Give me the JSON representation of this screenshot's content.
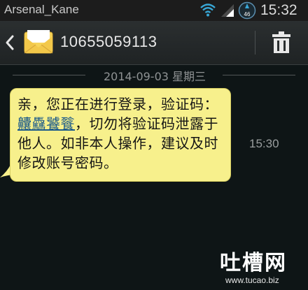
{
  "status_bar": {
    "carrier": "Arsenal_Kane",
    "network_badge": "46",
    "time": "15:32",
    "icons": [
      "wifi-icon",
      "signal-icon",
      "network-activity-icon"
    ]
  },
  "header": {
    "contact": "10655059113",
    "icons": [
      "back-icon",
      "envelope-icon",
      "trash-icon"
    ]
  },
  "conversation": {
    "date_separator": "2014-09-03 星期三",
    "messages": [
      {
        "text_before": "亲，您正在进行登录，验证码：",
        "code": "齉驫饕餮",
        "text_after": "，切勿将验证码泄露于他人。如非本人操作，建议及时修改账号密码。",
        "time": "15:30"
      }
    ]
  },
  "watermark": {
    "text": "吐槽网",
    "url": "www.tucao.biz"
  },
  "colors": {
    "background": "#0e1516",
    "bubble": "#f7f08c",
    "header": "#2b2f30",
    "link": "#1d5b8a"
  }
}
